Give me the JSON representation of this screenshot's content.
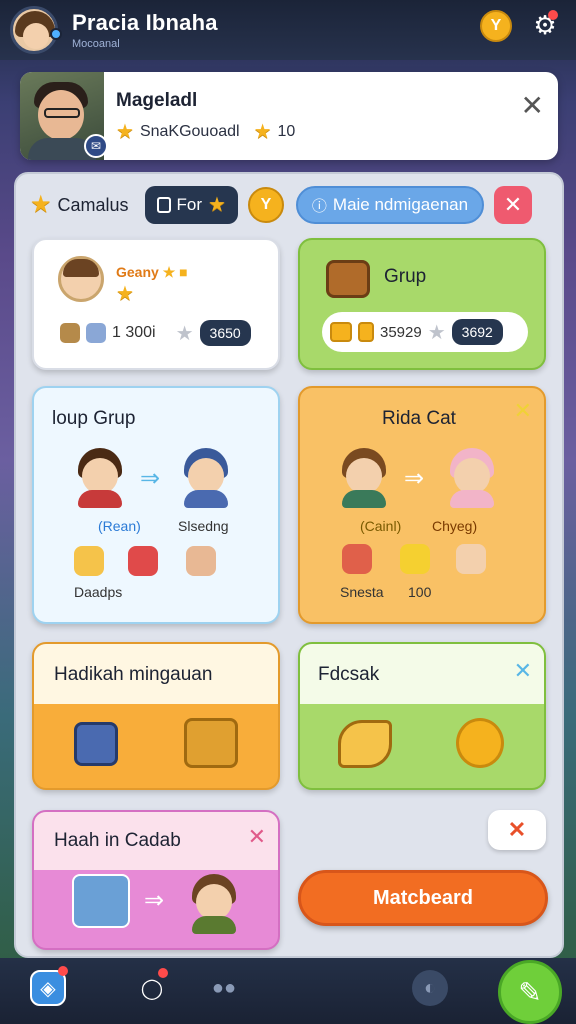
{
  "header": {
    "name": "Pracia Ibnaha",
    "subtitle": "Mocoanal",
    "coin_label": "Y"
  },
  "profile": {
    "name": "Mageladl",
    "stat_label": "SnaKGouoadl",
    "stat_value": "10"
  },
  "filter": {
    "label": "Camalus",
    "pill_label": "For",
    "coin_label": "Y",
    "search_label": "Maie ndmigaenan"
  },
  "cards": {
    "card1": {
      "tag": "Geany",
      "value_text": "1 300i",
      "badge": "3650"
    },
    "card2": {
      "title": "Grup",
      "value_text": "35929",
      "badge": "3692"
    },
    "card3": {
      "title": "loup Grup",
      "label_a": "(Rean)",
      "label_b": "Slsedng",
      "label_c": "Daadps"
    },
    "card4": {
      "title": "Rida Cat",
      "label_a": "(Cainl)",
      "label_b": "Chyeg)",
      "label_c": "Snesta",
      "label_d": "100"
    },
    "card5": {
      "title": "Hadikah mingauan"
    },
    "card6": {
      "title": "Fdcsak"
    },
    "card7": {
      "title": "Haah in Cadab"
    }
  },
  "match_button": "Matcbeard",
  "colors": {
    "accent_orange": "#f26d22",
    "accent_green": "#a8d96a",
    "accent_blue": "#6aa7e8",
    "accent_red": "#ef5a6f"
  }
}
